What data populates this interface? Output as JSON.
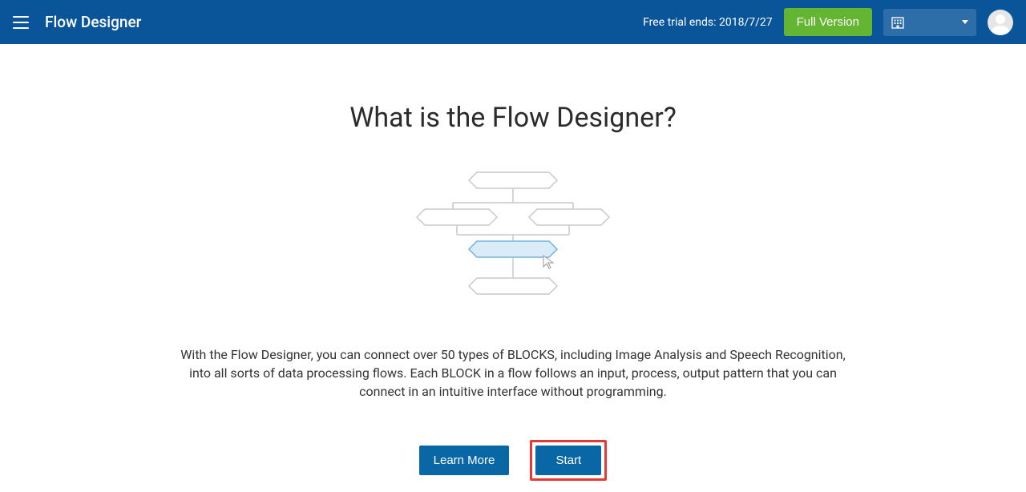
{
  "header": {
    "app_title": "Flow Designer",
    "trial_text": "Free trial ends: 2018/7/27",
    "full_version_label": "Full Version"
  },
  "main": {
    "title": "What is the Flow Designer?",
    "description": "With the Flow Designer, you can connect over 50 types of BLOCKS, including Image Analysis and Speech Recognition, into all sorts of data processing flows. Each BLOCK in a flow follows an input, process, output pattern that you can connect in an intuitive interface without programming.",
    "learn_more_label": "Learn More",
    "start_label": "Start"
  }
}
